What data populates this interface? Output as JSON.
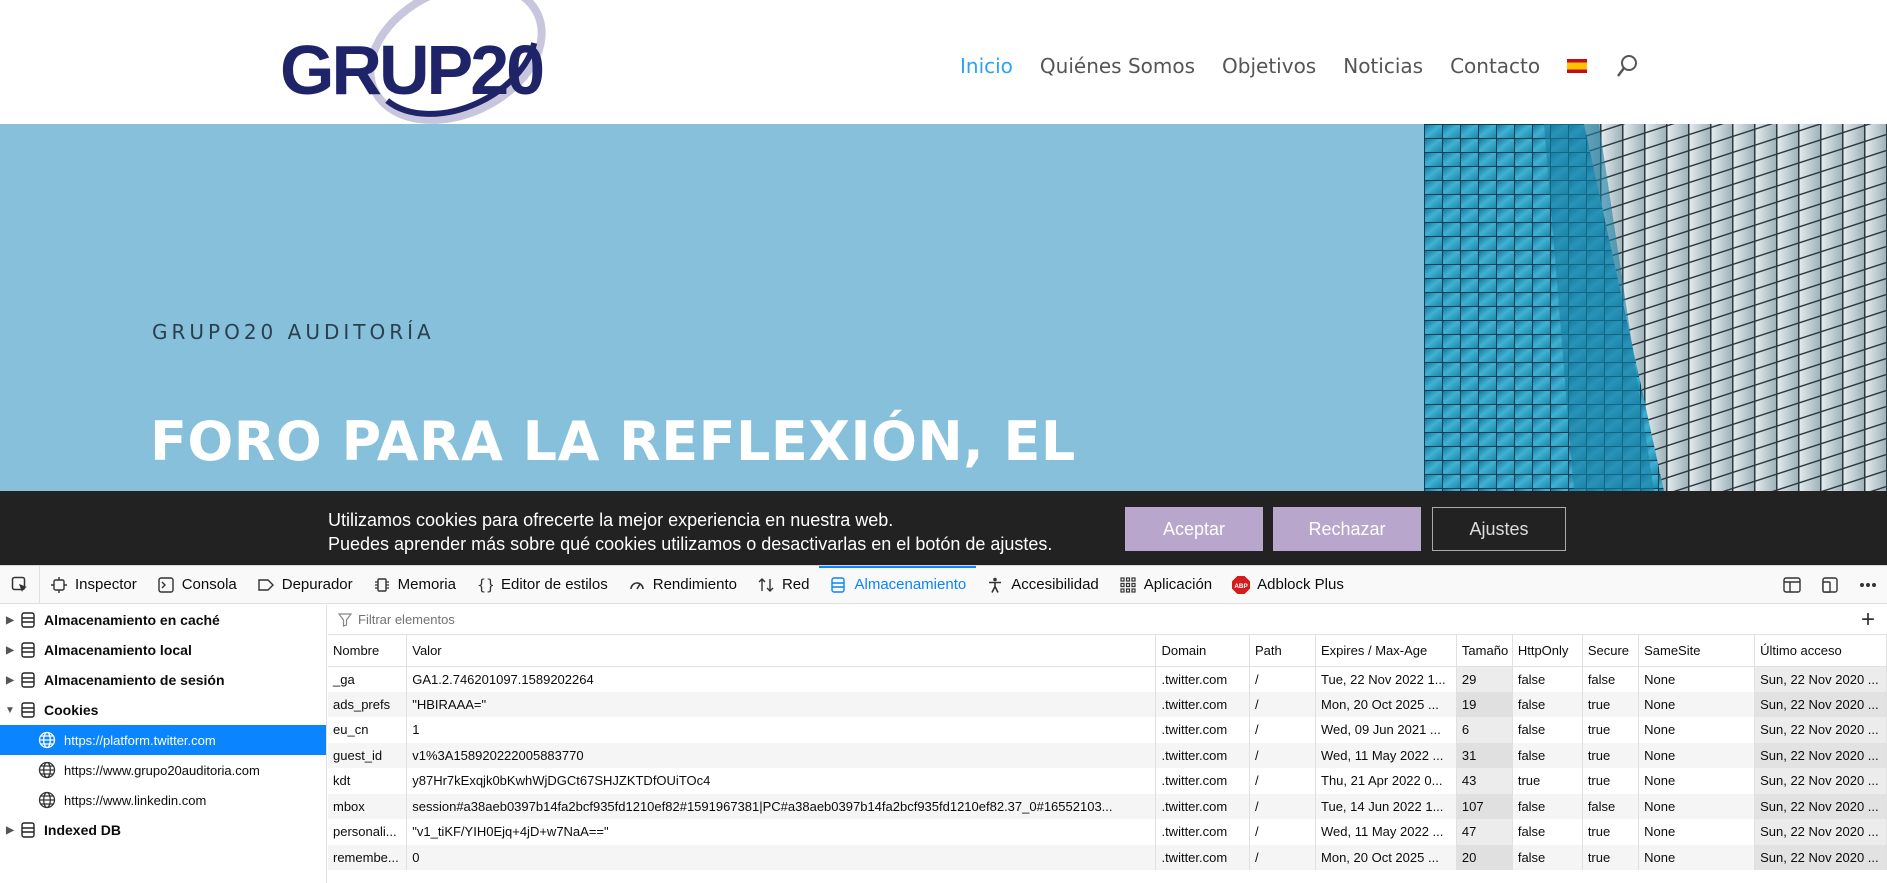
{
  "site": {
    "logo_text": "GRUP20",
    "nav": [
      {
        "label": "Inicio",
        "active": true
      },
      {
        "label": "Quiénes Somos",
        "active": false
      },
      {
        "label": "Objetivos",
        "active": false
      },
      {
        "label": "Noticias",
        "active": false
      },
      {
        "label": "Contacto",
        "active": false
      }
    ],
    "accent_color": "#2ea3f2"
  },
  "hero": {
    "kicker": "GRUPO20 AUDITORÍA",
    "title": "FORO PARA LA REFLEXIÓN, EL",
    "background": "#87c0da"
  },
  "cookie_banner": {
    "line1": "Utilizamos cookies para ofrecerte la mejor experiencia en nuestra web.",
    "line2": "Puedes aprender más sobre qué cookies utilizamos o desactivarlas en el botón de ajustes.",
    "accept_label": "Aceptar",
    "reject_label": "Rechazar",
    "settings_label": "Ajustes"
  },
  "devtools": {
    "tabs": [
      {
        "label": "Inspector",
        "icon": "inspector-icon"
      },
      {
        "label": "Consola",
        "icon": "console-icon"
      },
      {
        "label": "Depurador",
        "icon": "debugger-icon"
      },
      {
        "label": "Memoria",
        "icon": "memory-icon"
      },
      {
        "label": "Editor de estilos",
        "icon": "style-editor-icon"
      },
      {
        "label": "Rendimiento",
        "icon": "performance-icon"
      },
      {
        "label": "Red",
        "icon": "network-icon"
      },
      {
        "label": "Almacenamiento",
        "icon": "storage-icon",
        "selected": true
      },
      {
        "label": "Accesibilidad",
        "icon": "accessibility-icon"
      },
      {
        "label": "Aplicación",
        "icon": "application-icon"
      },
      {
        "label": "Adblock Plus",
        "icon": "adblock-icon"
      }
    ],
    "tree": [
      {
        "label": "Almacenamiento en caché",
        "expanded": false
      },
      {
        "label": "Almacenamiento local",
        "expanded": false
      },
      {
        "label": "Almacenamiento de sesión",
        "expanded": false
      },
      {
        "label": "Cookies",
        "expanded": true,
        "children": [
          {
            "label": "https://platform.twitter.com",
            "selected": true
          },
          {
            "label": "https://www.grupo20auditoria.com"
          },
          {
            "label": "https://www.linkedin.com"
          }
        ]
      },
      {
        "label": "Indexed DB",
        "expanded": false
      }
    ],
    "filter_placeholder": "Filtrar elementos",
    "columns": [
      "Nombre",
      "Valor",
      "Domain",
      "Path",
      "Expires / Max-Age",
      "Tamaño",
      "HttpOnly",
      "Secure",
      "SameSite",
      "Último acceso"
    ],
    "rows": [
      [
        "_ga",
        "GA1.2.746201097.1589202264",
        ".twitter.com",
        "/",
        "Tue, 22 Nov 2022 1...",
        "29",
        "false",
        "false",
        "None",
        "Sun, 22 Nov 2020 ..."
      ],
      [
        "ads_prefs",
        "\"HBIRAAA=\"",
        ".twitter.com",
        "/",
        "Mon, 20 Oct 2025 ...",
        "19",
        "false",
        "true",
        "None",
        "Sun, 22 Nov 2020 ..."
      ],
      [
        "eu_cn",
        "1",
        ".twitter.com",
        "/",
        "Wed, 09 Jun 2021 ...",
        "6",
        "false",
        "true",
        "None",
        "Sun, 22 Nov 2020 ..."
      ],
      [
        "guest_id",
        "v1%3A158920222005883770",
        ".twitter.com",
        "/",
        "Wed, 11 May 2022 ...",
        "31",
        "false",
        "true",
        "None",
        "Sun, 22 Nov 2020 ..."
      ],
      [
        "kdt",
        "y87Hr7kExqjk0bKwhWjDGCt67SHJZKTDfOUiTOc4",
        ".twitter.com",
        "/",
        "Thu, 21 Apr 2022 0...",
        "43",
        "true",
        "true",
        "None",
        "Sun, 22 Nov 2020 ..."
      ],
      [
        "mbox",
        "session#a38aeb0397b14fa2bcf935fd1210ef82#1591967381|PC#a38aeb0397b14fa2bcf935fd1210ef82.37_0#16552103...",
        ".twitter.com",
        "/",
        "Tue, 14 Jun 2022 1...",
        "107",
        "false",
        "false",
        "None",
        "Sun, 22 Nov 2020 ..."
      ],
      [
        "personali...",
        "\"v1_tiKF/YIH0Ejq+4jD+w7NaA==\"",
        ".twitter.com",
        "/",
        "Wed, 11 May 2022 ...",
        "47",
        "false",
        "true",
        "None",
        "Sun, 22 Nov 2020 ..."
      ],
      [
        "remembe...",
        "0",
        ".twitter.com",
        "/",
        "Mon, 20 Oct 2025 ...",
        "20",
        "false",
        "true",
        "None",
        "Sun, 22 Nov 2020 ..."
      ]
    ]
  }
}
